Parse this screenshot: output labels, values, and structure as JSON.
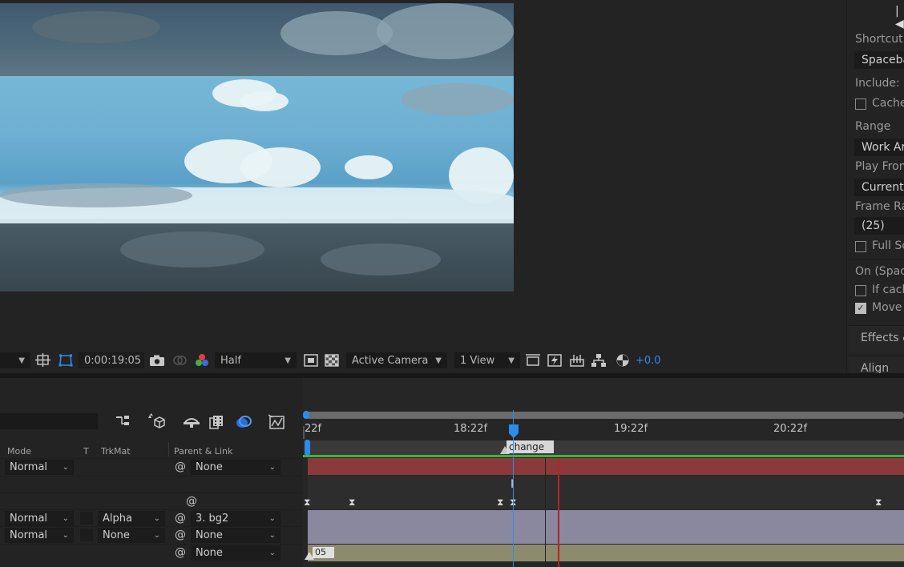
{
  "viewer_toolbar": {
    "timecode": "0:00:19:05",
    "resolution": "Half",
    "camera": "Active Camera",
    "view": "1 View",
    "exposure": "+0.0"
  },
  "preview_panel": {
    "shortcut_label": "Shortcut",
    "shortcut_value": "Spacebar",
    "include_label": "Include:",
    "cache_label": "Cache",
    "range_label": "Range",
    "range_value": "Work Are",
    "play_from_label": "Play From",
    "play_from_value": "Current T",
    "frame_rate_label": "Frame Rat",
    "frame_rate_value": "(25)",
    "full_screen_label": "Full Sc",
    "on_spacebar_label": "On (Space",
    "if_caching_label": "If cachi",
    "move_label": "Move t",
    "move_checked": true,
    "effects_tab": "Effects &",
    "align_tab": "Align"
  },
  "timeline": {
    "columns": {
      "mode": "Mode",
      "t": "T",
      "trkmat": "TrkMat",
      "parent": "Parent & Link"
    },
    "rows": [
      {
        "mode": "Normal",
        "trkmat": "",
        "parent": "None"
      },
      {
        "mode": "",
        "trkmat": "",
        "parent": ""
      },
      {
        "mode": "Normal",
        "trkmat": "Alpha",
        "parent": "3. bg2"
      },
      {
        "mode": "Normal",
        "trkmat": "None",
        "parent": "None"
      },
      {
        "mode": "",
        "trkmat": "",
        "parent": "None"
      }
    ],
    "ruler": [
      "22f",
      "18:22f",
      "19:22f",
      "20:22f"
    ],
    "marker_label": "change",
    "layer_bar_label": "05"
  },
  "colors": {
    "accent_blue": "#2d8ceb",
    "track_red": "#8a3a3b",
    "track_lavender": "#8a889e",
    "track_khaki": "#8d8a6e",
    "work_area_green": "#3fb33f"
  }
}
